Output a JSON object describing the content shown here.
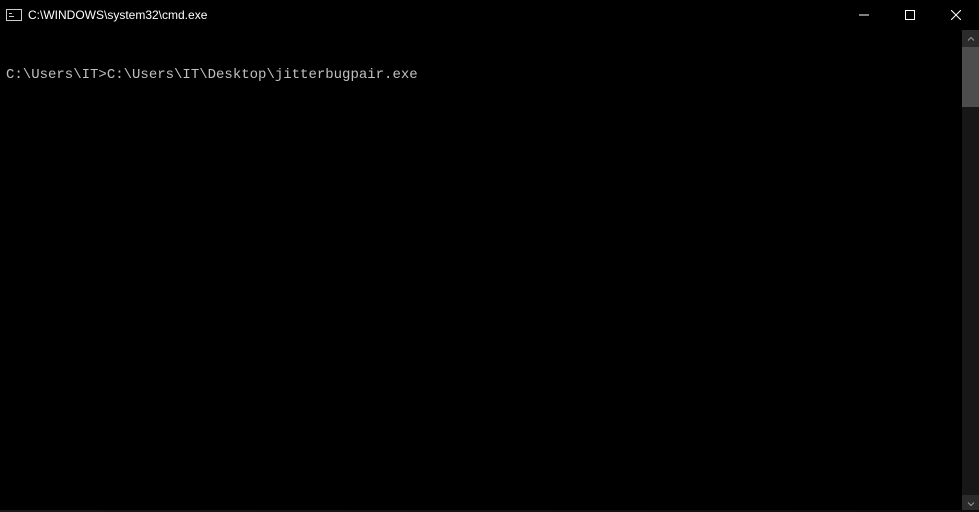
{
  "titlebar": {
    "title": "C:\\WINDOWS\\system32\\cmd.exe"
  },
  "terminal": {
    "line1": "C:\\Users\\IT>C:\\Users\\IT\\Desktop\\jitterbugpair.exe"
  }
}
